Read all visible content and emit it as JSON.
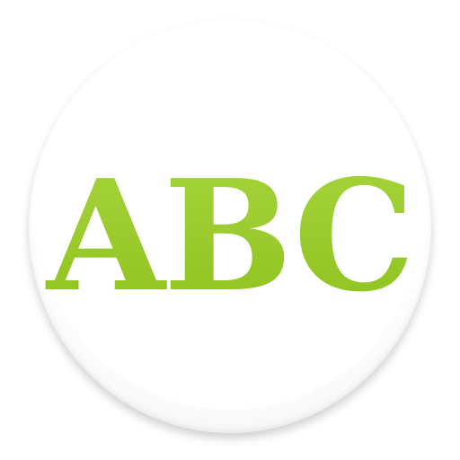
{
  "icon": {
    "text": "ABC",
    "text_color": "#9ccc2f",
    "background_color": "#ffffff"
  }
}
